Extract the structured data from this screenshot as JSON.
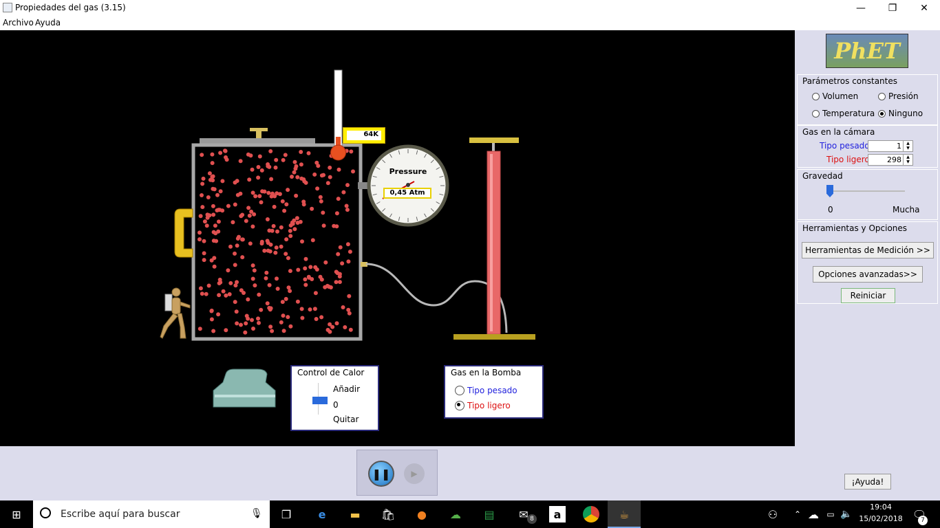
{
  "window": {
    "title": "Propiedades del gas (3.15)",
    "minimize_glyph": "—",
    "maximize_glyph": "❐",
    "close_glyph": "✕"
  },
  "menu": {
    "items": [
      "Archivo",
      "Ayuda"
    ]
  },
  "simulation": {
    "thermometer_reading": "64K",
    "gauge_title": "Pressure",
    "gauge_reading": "0,45 Atm",
    "heat_control": {
      "title": "Control de Calor",
      "add_label": "Añadir",
      "zero_label": "0",
      "remove_label": "Quitar"
    },
    "pump_gas": {
      "title": "Gas en la Bomba",
      "options": [
        "Tipo pesado",
        "Tipo ligero"
      ],
      "selected": "Tipo ligero"
    }
  },
  "panel": {
    "logo_text": "PhET",
    "constant_params": {
      "title": "Parámetros constantes",
      "options": [
        "Volumen",
        "Presión",
        "Temperatura",
        "Ninguno"
      ],
      "selected": "Ninguno"
    },
    "chamber_gas": {
      "title": "Gas en la cámara",
      "heavy_label": "Tipo pesado",
      "heavy_value": "1",
      "light_label": "Tipo ligero",
      "light_value": "298"
    },
    "gravity": {
      "title": "Gravedad",
      "min_label": "0",
      "max_label": "Mucha",
      "level": 0
    },
    "tools": {
      "title": "Herramientas y Opciones",
      "measure_button": "Herramientas de Medición >>",
      "advanced_button": "Opciones avanzadas>>",
      "reset_button": "Reiniciar"
    }
  },
  "controls": {
    "help_button": "¡Ayuda!"
  },
  "taskbar": {
    "search_placeholder": "Escribe aquí para buscar",
    "clock_time": "19:04",
    "clock_date": "15/02/2018",
    "notification_count": "7",
    "mail_badge": "8",
    "amazon_glyph": "a"
  },
  "colors": {
    "heavy_label": "#2222dd",
    "light_label": "#dd1111",
    "particle": "#e05050",
    "panel_bg": "#dcdcec",
    "pump_body": "#e86868"
  }
}
